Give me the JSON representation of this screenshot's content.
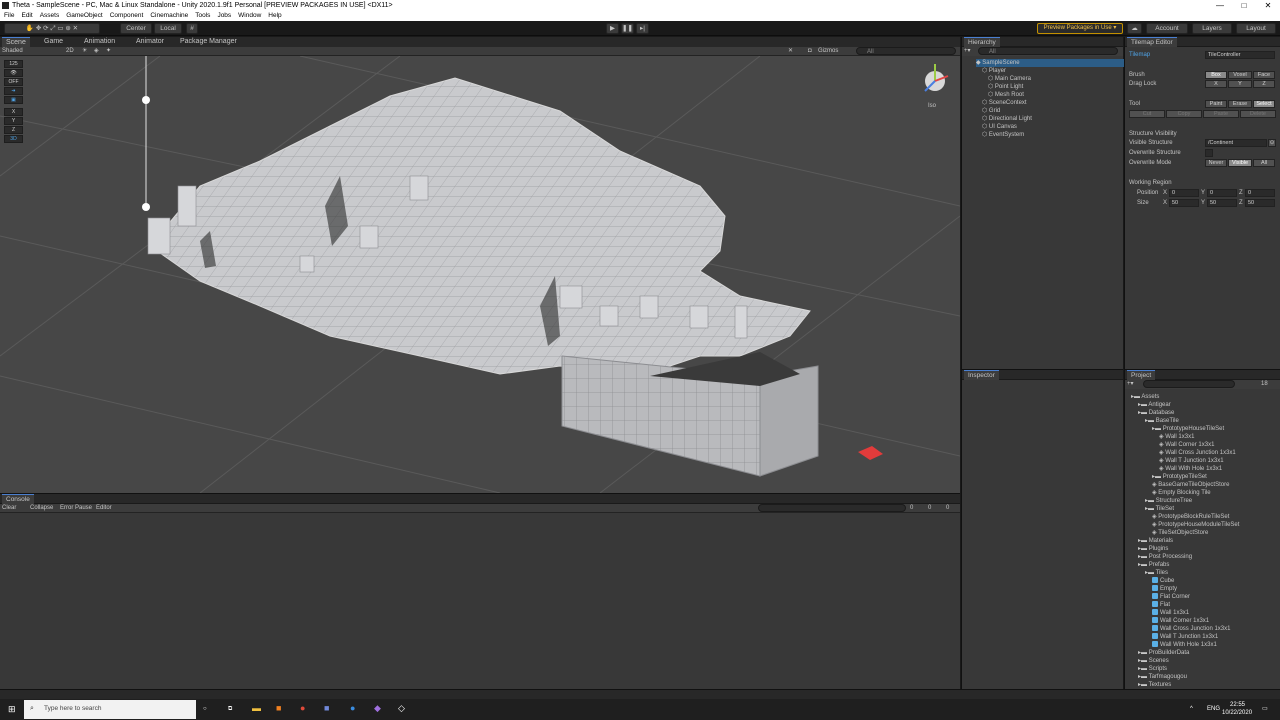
{
  "window": {
    "title": "Theta - SampleScene - PC, Mac & Linux Standalone - Unity 2020.1.9f1 Personal [PREVIEW PACKAGES IN USE] <DX11>",
    "controls": [
      "—",
      "□",
      "✕"
    ]
  },
  "menu": [
    "File",
    "Edit",
    "Assets",
    "GameObject",
    "Component",
    "Cinemachine",
    "Tools",
    "Jobs",
    "Window",
    "Help"
  ],
  "toolbar": {
    "pivot": "Center",
    "space": "Local",
    "preview_packages": "Preview Packages in Use ▾",
    "account": "Account",
    "layers": "Layers",
    "layout": "Layout"
  },
  "scene_tabs": [
    "Scene",
    "Game",
    "Animation",
    "Animator",
    "Package Manager"
  ],
  "scene_toolbar": {
    "shading": "Shaded",
    "mode": "2D",
    "gizmos": "Gizmos",
    "search_placeholder": "All"
  },
  "view_tools": [
    "125",
    "",
    "OFF",
    "",
    "",
    "X",
    "Y",
    "Z",
    "3D"
  ],
  "scene_gizmo_label": "Iso",
  "console": {
    "tab": "Console",
    "buttons": [
      "Clear",
      "Collapse",
      "Error Pause",
      "Editor"
    ],
    "counts": [
      "0",
      "0",
      "0"
    ]
  },
  "hierarchy": {
    "tab": "Hierarchy",
    "search_placeholder": "All",
    "items": [
      {
        "label": "SampleScene",
        "indent": 0
      },
      {
        "label": "Player",
        "indent": 1
      },
      {
        "label": "Main Camera",
        "indent": 2
      },
      {
        "label": "Point Light",
        "indent": 2
      },
      {
        "label": "Mesh Root",
        "indent": 2
      },
      {
        "label": "SceneContext",
        "indent": 1
      },
      {
        "label": "Grid",
        "indent": 1
      },
      {
        "label": "Directional Light",
        "indent": 1
      },
      {
        "label": "UI Canvas",
        "indent": 1
      },
      {
        "label": "EventSystem",
        "indent": 1
      }
    ]
  },
  "tilemap_editor": {
    "tab": "Tilemap Editor",
    "tilemap_label": "Tilemap",
    "tilemap_value": "TileController",
    "brush_label": "Brush",
    "brush_options": [
      "Box",
      "Voxel",
      "Face"
    ],
    "drag_lock_label": "Drag Lock",
    "drag_lock_options": [
      "X",
      "Y",
      "Z"
    ],
    "tool_label": "Tool",
    "tool_options": [
      "Paint",
      "Erase",
      "Select"
    ],
    "edit_options": [
      "Cut",
      "Copy",
      "Paste",
      "Delete"
    ],
    "structure_visibility": "Structure Visibility",
    "visible_structure_label": "Visible Structure",
    "visible_structure_value": "/Continent",
    "overwrite_structure_label": "Overwrite Structure",
    "overwrite_mode_label": "Overwrite Mode",
    "overwrite_mode_options": [
      "Never",
      "Visible",
      "All"
    ],
    "working_region": "Working Region",
    "position_label": "Position",
    "size_label": "Size",
    "position": {
      "x": "0",
      "y": "0",
      "z": "0"
    },
    "size": {
      "x": "50",
      "y": "50",
      "z": "50"
    }
  },
  "inspector": {
    "tab": "Inspector"
  },
  "project": {
    "tab": "Project",
    "count": "18",
    "items": [
      {
        "label": "Assets",
        "indent": 0,
        "kind": "folder"
      },
      {
        "label": "Antigear",
        "indent": 1,
        "kind": "folder"
      },
      {
        "label": "Database",
        "indent": 1,
        "kind": "folder"
      },
      {
        "label": "BaseTile",
        "indent": 2,
        "kind": "folder"
      },
      {
        "label": "PrototypeHouseTileSet",
        "indent": 3,
        "kind": "folder"
      },
      {
        "label": "Wall 1x3x1",
        "indent": 4,
        "kind": "asset"
      },
      {
        "label": "Wall Corner 1x3x1",
        "indent": 4,
        "kind": "asset"
      },
      {
        "label": "Wall Cross Junction 1x3x1",
        "indent": 4,
        "kind": "asset"
      },
      {
        "label": "Wall T Junction 1x3x1",
        "indent": 4,
        "kind": "asset"
      },
      {
        "label": "Wall With Hole 1x3x1",
        "indent": 4,
        "kind": "asset"
      },
      {
        "label": "PrototypeTileSet",
        "indent": 3,
        "kind": "folder"
      },
      {
        "label": "BaseGameTileObjectStore",
        "indent": 3,
        "kind": "asset"
      },
      {
        "label": "Empty Blocking Tile",
        "indent": 3,
        "kind": "asset"
      },
      {
        "label": "StructureTree",
        "indent": 2,
        "kind": "folder"
      },
      {
        "label": "TileSet",
        "indent": 2,
        "kind": "folder"
      },
      {
        "label": "PrototypeBlockRuleTileSet",
        "indent": 3,
        "kind": "asset"
      },
      {
        "label": "PrototypeHouseModuleTileSet",
        "indent": 3,
        "kind": "asset"
      },
      {
        "label": "TileSetObjectStore",
        "indent": 3,
        "kind": "asset"
      },
      {
        "label": "Materials",
        "indent": 1,
        "kind": "folder"
      },
      {
        "label": "Plugins",
        "indent": 1,
        "kind": "folder"
      },
      {
        "label": "Post Processing",
        "indent": 1,
        "kind": "folder"
      },
      {
        "label": "Prefabs",
        "indent": 1,
        "kind": "folder"
      },
      {
        "label": "Tiles",
        "indent": 2,
        "kind": "folder"
      },
      {
        "label": "Cube",
        "indent": 3,
        "kind": "prefab"
      },
      {
        "label": "Empty",
        "indent": 3,
        "kind": "prefab"
      },
      {
        "label": "Flat Corner",
        "indent": 3,
        "kind": "prefab"
      },
      {
        "label": "Flat",
        "indent": 3,
        "kind": "prefab"
      },
      {
        "label": "Wall 1x3x1",
        "indent": 3,
        "kind": "prefab"
      },
      {
        "label": "Wall Corner 1x3x1",
        "indent": 3,
        "kind": "prefab"
      },
      {
        "label": "Wall Cross Junction 1x3x1",
        "indent": 3,
        "kind": "prefab"
      },
      {
        "label": "Wall T Junction 1x3x1",
        "indent": 3,
        "kind": "prefab"
      },
      {
        "label": "Wall With Hole 1x3x1",
        "indent": 3,
        "kind": "prefab"
      },
      {
        "label": "ProBuilderData",
        "indent": 1,
        "kind": "folder"
      },
      {
        "label": "Scenes",
        "indent": 1,
        "kind": "folder"
      },
      {
        "label": "Scripts",
        "indent": 1,
        "kind": "folder"
      },
      {
        "label": "Tarfmagougou",
        "indent": 1,
        "kind": "folder"
      },
      {
        "label": "Textures",
        "indent": 1,
        "kind": "folder"
      }
    ]
  },
  "taskbar": {
    "search_placeholder": "Type here to search",
    "language": "ENG",
    "time": "22:55",
    "date": "10/22/2020"
  }
}
